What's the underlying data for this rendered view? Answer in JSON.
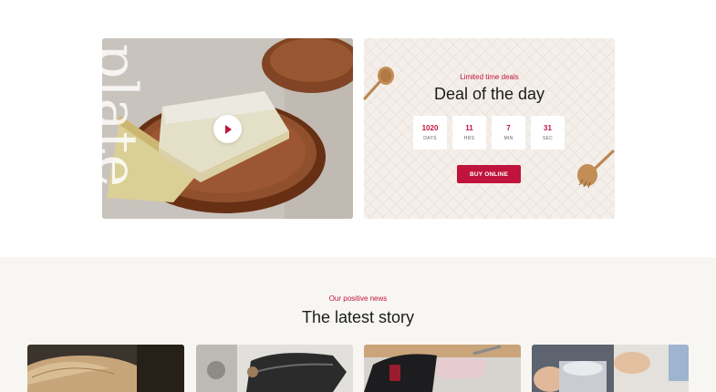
{
  "hero": {
    "vertical_word": "plate",
    "play_label": "Play video"
  },
  "deal": {
    "kicker": "Limited time deals",
    "title": "Deal of the day",
    "timer": [
      {
        "value": "1020",
        "unit": "DAYS"
      },
      {
        "value": "11",
        "unit": "HRS"
      },
      {
        "value": "7",
        "unit": "MIN"
      },
      {
        "value": "31",
        "unit": "SEC"
      }
    ],
    "button": "BUY ONLINE"
  },
  "news": {
    "kicker": "Our positive news",
    "title": "The latest story"
  },
  "colors": {
    "accent": "#c0143c",
    "section_bg": "#f8f6f2",
    "deal_bg": "#f4efea"
  }
}
